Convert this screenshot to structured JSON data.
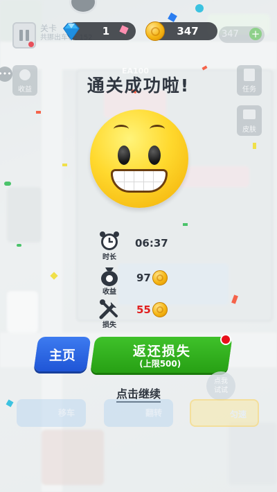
{
  "hud": {
    "level_label": "关卡",
    "level_sub": "共挪出车辆: 152",
    "gems": "1",
    "coins": "347",
    "ghost_coins": "347"
  },
  "side": {
    "left_top": "收益",
    "right_top": "任务",
    "right_second": "皮肤",
    "ground_label": "EA100"
  },
  "result": {
    "title": "通关成功啦!",
    "stats": [
      {
        "caption": "时长",
        "value": "06:37",
        "icon": "alarm-clock-icon"
      },
      {
        "caption": "收益",
        "value": "97",
        "icon": "money-bag-icon"
      },
      {
        "caption": "损失",
        "value": "55",
        "icon": "tools-icon"
      }
    ]
  },
  "buttons": {
    "home": "主页",
    "return_loss": "返还损失",
    "return_cap": "(上限500)",
    "continue": "点击继续",
    "reward_badge": "点我\n试试",
    "faded": [
      "移车",
      "翻转",
      "匀速"
    ]
  },
  "colors": {
    "home_btn": "#2a62e0",
    "return_btn": "#2fb01c",
    "loss_value": "#e02020",
    "coin": "#f5b614"
  }
}
